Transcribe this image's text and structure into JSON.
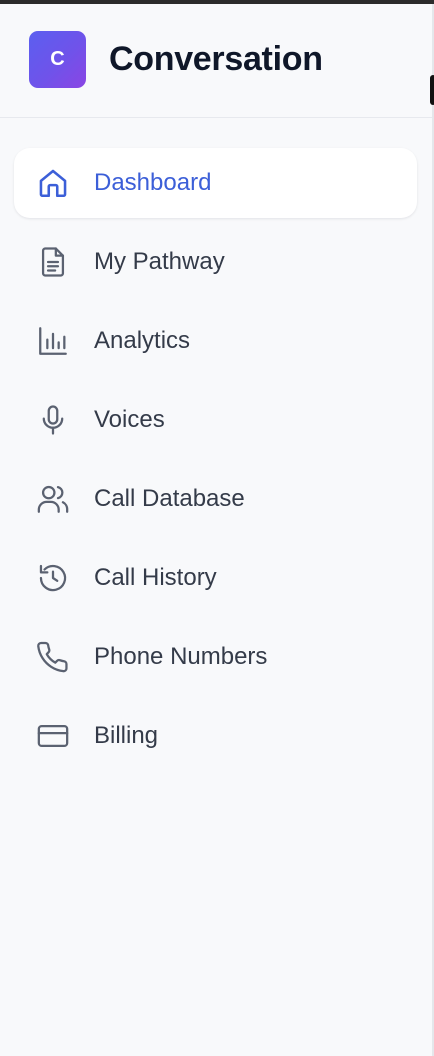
{
  "app": {
    "logo_letter": "C",
    "title": "Conversation"
  },
  "colors": {
    "accent": "#3c5fd8",
    "text": "#343b49",
    "logo_gradient_start": "#5b5ff0",
    "logo_gradient_end": "#8a45e4",
    "sidebar_bg": "#f8f9fb"
  },
  "sidebar": {
    "items": [
      {
        "label": "Dashboard",
        "icon": "home-icon",
        "active": true
      },
      {
        "label": "My Pathway",
        "icon": "document-icon",
        "active": false
      },
      {
        "label": "Analytics",
        "icon": "bar-chart-icon",
        "active": false
      },
      {
        "label": "Voices",
        "icon": "microphone-icon",
        "active": false
      },
      {
        "label": "Call Database",
        "icon": "users-icon",
        "active": false
      },
      {
        "label": "Call History",
        "icon": "history-icon",
        "active": false
      },
      {
        "label": "Phone Numbers",
        "icon": "phone-icon",
        "active": false
      },
      {
        "label": "Billing",
        "icon": "credit-card-icon",
        "active": false
      }
    ]
  }
}
